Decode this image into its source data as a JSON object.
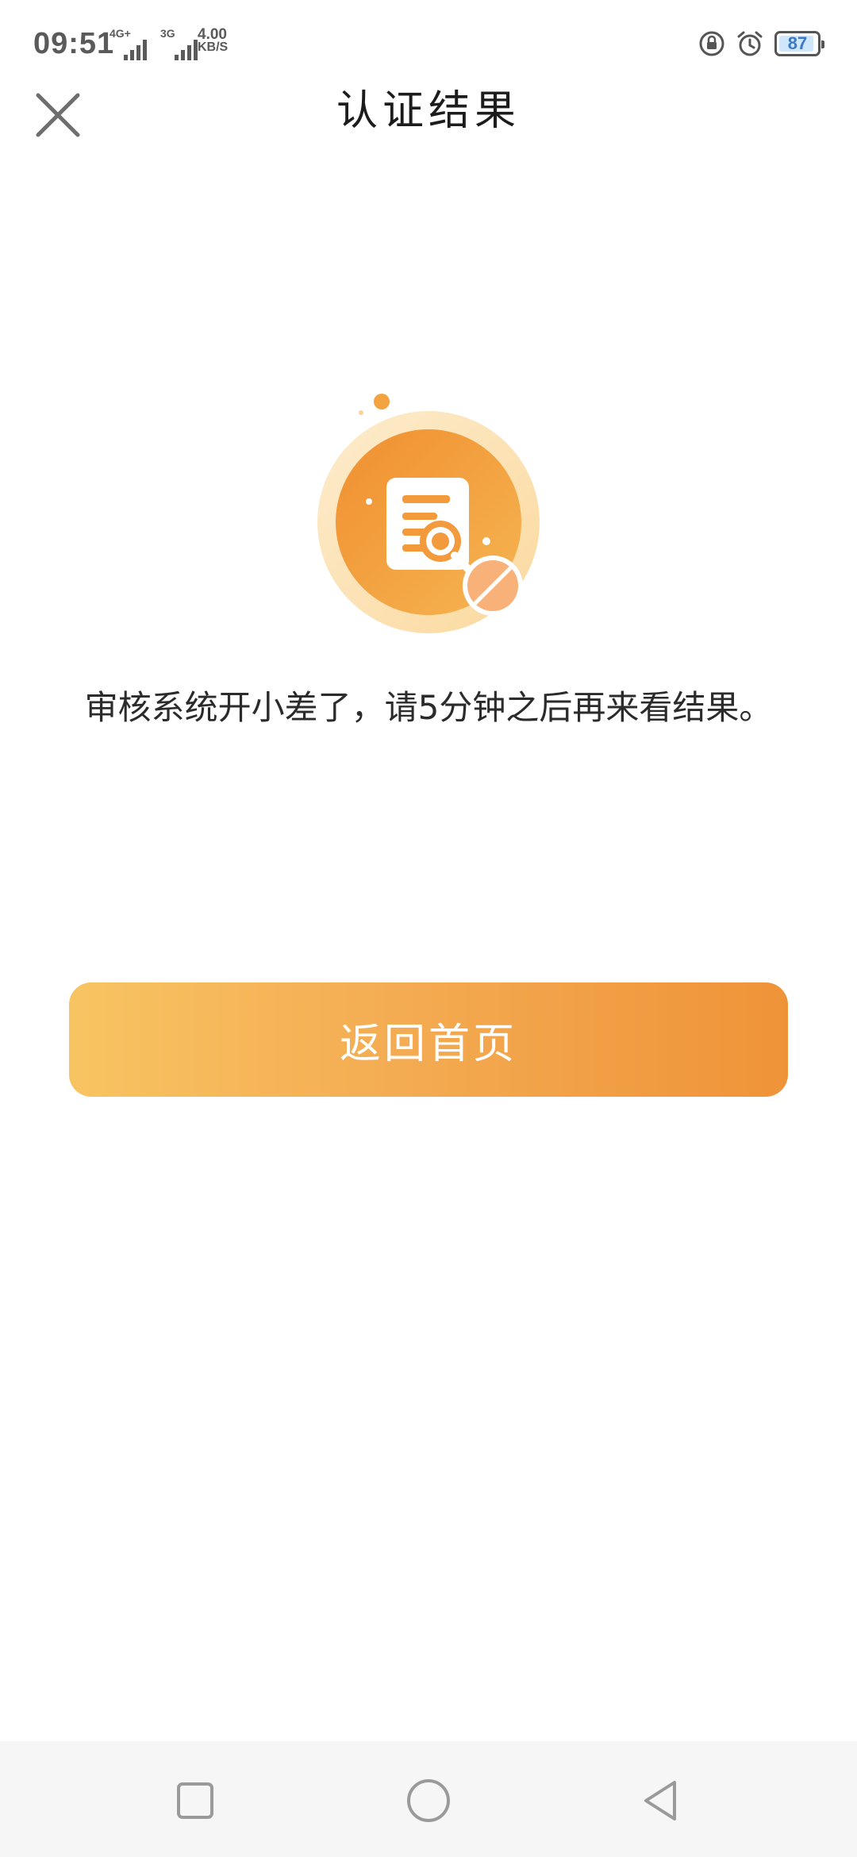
{
  "status_bar": {
    "time": "09:51",
    "network1": "4G+",
    "network2": "3G",
    "speed_value": "4.00",
    "speed_unit": "KB/S",
    "battery_level": "87",
    "icons": [
      "orientation-lock-icon",
      "alarm-icon",
      "battery-icon"
    ]
  },
  "header": {
    "title": "认证结果",
    "close_icon": "close-icon"
  },
  "illustration": {
    "icon": "document-review-rejected-icon",
    "colors": {
      "accent": "#f39a3c",
      "light": "#fde7c2"
    }
  },
  "message": "审核系统开小差了，请5分钟之后再来看结果。",
  "primary_button": {
    "label": "返回首页",
    "colors": {
      "start": "#f8c462",
      "end": "#ef9338"
    }
  },
  "nav_bar": {
    "buttons": [
      "recent-apps-icon",
      "home-icon",
      "back-icon"
    ]
  }
}
